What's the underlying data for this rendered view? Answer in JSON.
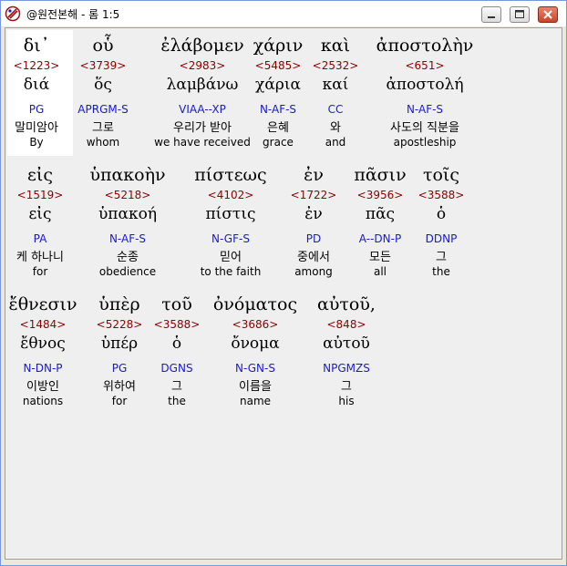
{
  "window": {
    "title": "@원전본해 - 롬 1:5"
  },
  "rows": [
    {
      "words": [
        {
          "greek": "δι᾽",
          "num": "<1223>",
          "lemma": "διά",
          "parse": "PG",
          "korean": "말미암아",
          "english": "By"
        },
        {
          "greek": "οὗ",
          "num": "<3739>",
          "lemma": "ὅς",
          "parse": "APRGM-S",
          "korean": "그로",
          "english": "whom"
        },
        {
          "greek": "ἐλάβομεν",
          "num": "<2983>",
          "lemma": "λαμβάνω",
          "parse": "VIAA--XP",
          "korean": "우리가 받아",
          "english": "we have received"
        },
        {
          "greek": "χάριν",
          "num": "<5485>",
          "lemma": "χάρια",
          "parse": "N-AF-S",
          "korean": "은혜",
          "english": "grace"
        },
        {
          "greek": "καὶ",
          "num": "<2532>",
          "lemma": "καί",
          "parse": "CC",
          "korean": "와",
          "english": "and"
        },
        {
          "greek": "ἀποστολὴν",
          "num": "<651>",
          "lemma": "ἀποστολή",
          "parse": "N-AF-S",
          "korean": "사도의 직분을",
          "english": "apostleship"
        }
      ]
    },
    {
      "words": [
        {
          "greek": "εἰς",
          "num": "<1519>",
          "lemma": "εἰς",
          "parse": "PA",
          "korean": "케 하나니",
          "english": "for"
        },
        {
          "greek": "ὑπακοὴν",
          "num": "<5218>",
          "lemma": "ὑπακοή",
          "parse": "N-AF-S",
          "korean": "순종",
          "english": "obedience"
        },
        {
          "greek": "πίστεως",
          "num": "<4102>",
          "lemma": "πίστις",
          "parse": "N-GF-S",
          "korean": "믿어",
          "english": "to the faith"
        },
        {
          "greek": "ἐν",
          "num": "<1722>",
          "lemma": "ἐν",
          "parse": "PD",
          "korean": "중에서",
          "english": "among"
        },
        {
          "greek": "πᾶσιν",
          "num": "<3956>",
          "lemma": "πᾶς",
          "parse": "A--DN-P",
          "korean": "모든",
          "english": "all"
        },
        {
          "greek": "τοῖς",
          "num": "<3588>",
          "lemma": "ὁ",
          "parse": "DDNP",
          "korean": "그",
          "english": "the"
        }
      ]
    },
    {
      "words": [
        {
          "greek": "ἔθνεσιν",
          "num": "<1484>",
          "lemma": "ἔθνος",
          "parse": "N-DN-P",
          "korean": "이방인",
          "english": "nations"
        },
        {
          "greek": "ὑπὲρ",
          "num": "<5228>",
          "lemma": "ὑπέρ",
          "parse": "PG",
          "korean": "위하여",
          "english": "for"
        },
        {
          "greek": "τοῦ",
          "num": "<3588>",
          "lemma": "ὁ",
          "parse": "DGNS",
          "korean": "그",
          "english": "the"
        },
        {
          "greek": "ὀνόματος",
          "num": "<3686>",
          "lemma": "ὄνομα",
          "parse": "N-GN-S",
          "korean": "이름을",
          "english": "name"
        },
        {
          "greek": "αὐτοῦ,",
          "num": "<848>",
          "lemma": "αὐτοῦ",
          "parse": "NPGMZS",
          "korean": "그",
          "english": "his"
        }
      ]
    }
  ]
}
